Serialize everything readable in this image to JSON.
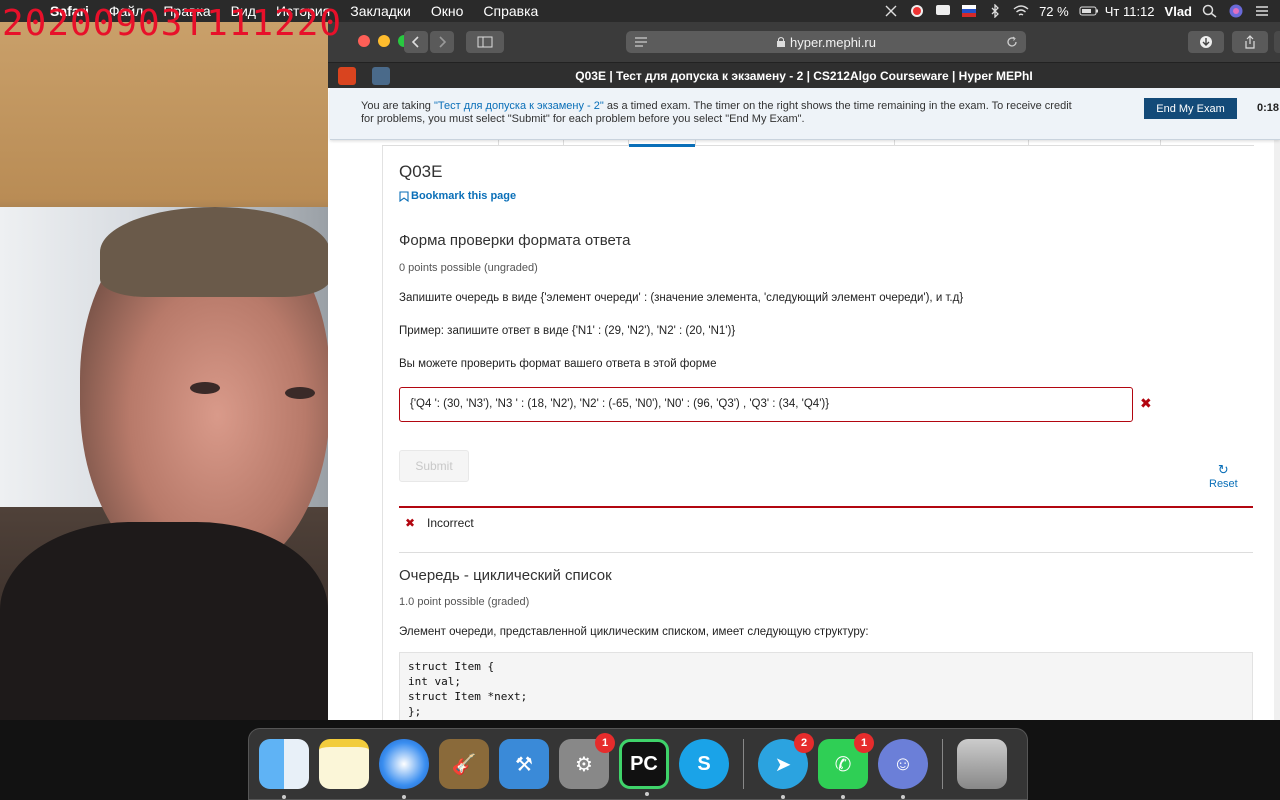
{
  "timestamp": "20200903T111220",
  "menubar": {
    "apple_glyph": "",
    "items": [
      "Safari",
      "Файл",
      "Правка",
      "Вид",
      "История",
      "Закладки",
      "Окно",
      "Справка"
    ],
    "battery": "72 %",
    "clock": "Чт 11:12",
    "user": "Vlad"
  },
  "browser": {
    "url": "hyper.mephi.ru",
    "tab_title": "Q03E | Тест для допуска к экзамену - 2 | CS212Algo Courseware | Hyper MEPhI"
  },
  "exam_banner": {
    "msg_prefix": "You are taking ",
    "exam_name": "\"Тест для допуска к экзамену - 2\"",
    "msg_suffix": " as a timed exam. The timer on the right shows the time remaining in the exam. To receive credit for problems, you must select \"Submit\" for each problem before you select \"End My Exam\".",
    "end_button": "End My Exam",
    "timer": "0:18:"
  },
  "unit": {
    "title": "Q03E",
    "bookmark": "Bookmark this page"
  },
  "problem1": {
    "title": "Форма проверки формата ответа",
    "meta": "0 points possible (ungraded)",
    "line1": "Запишите очередь в виде {'элемент очереди' : (значение элемента, 'следующий элемент очереди'), и т.д}",
    "line2": "Пример: запишите ответ в виде {'N1' : (29, 'N2'), 'N2' : (20, 'N1')}",
    "line3": "Вы можете проверить формат вашего ответа в этой форме",
    "answer": "{'Q4 ': (30, 'N3'), 'N3 ' : (18, 'N2'), 'N2' : (-65, 'N0'), 'N0' : (96, 'Q3') , 'Q3' : (34, 'Q4')}",
    "submit": "Submit",
    "reset": "Reset",
    "status": "Incorrect"
  },
  "problem2": {
    "title": "Очередь - циклический список",
    "meta": "1.0 point possible (graded)",
    "line1": "Элемент очереди, представленной циклическим списком, имеет следующую структуру:",
    "code": "struct Item {\nint val;\nstruct Item *next;\n};"
  },
  "dock": {
    "apps": [
      {
        "name": "Finder",
        "badge": ""
      },
      {
        "name": "Notes",
        "badge": ""
      },
      {
        "name": "Safari",
        "badge": ""
      },
      {
        "name": "GarageBand",
        "badge": ""
      },
      {
        "name": "Xcode",
        "badge": ""
      },
      {
        "name": "System Preferences",
        "badge": "1"
      },
      {
        "name": "PyCharm",
        "badge": ""
      },
      {
        "name": "Skype",
        "badge": ""
      },
      {
        "name": "Telegram",
        "badge": "2"
      },
      {
        "name": "FaceTime",
        "badge": "1"
      },
      {
        "name": "Discord",
        "badge": ""
      },
      {
        "name": "Trash",
        "badge": ""
      }
    ]
  },
  "colors": {
    "link": "#0a6fb8",
    "error": "#b20610",
    "exam_button": "#134a78"
  }
}
